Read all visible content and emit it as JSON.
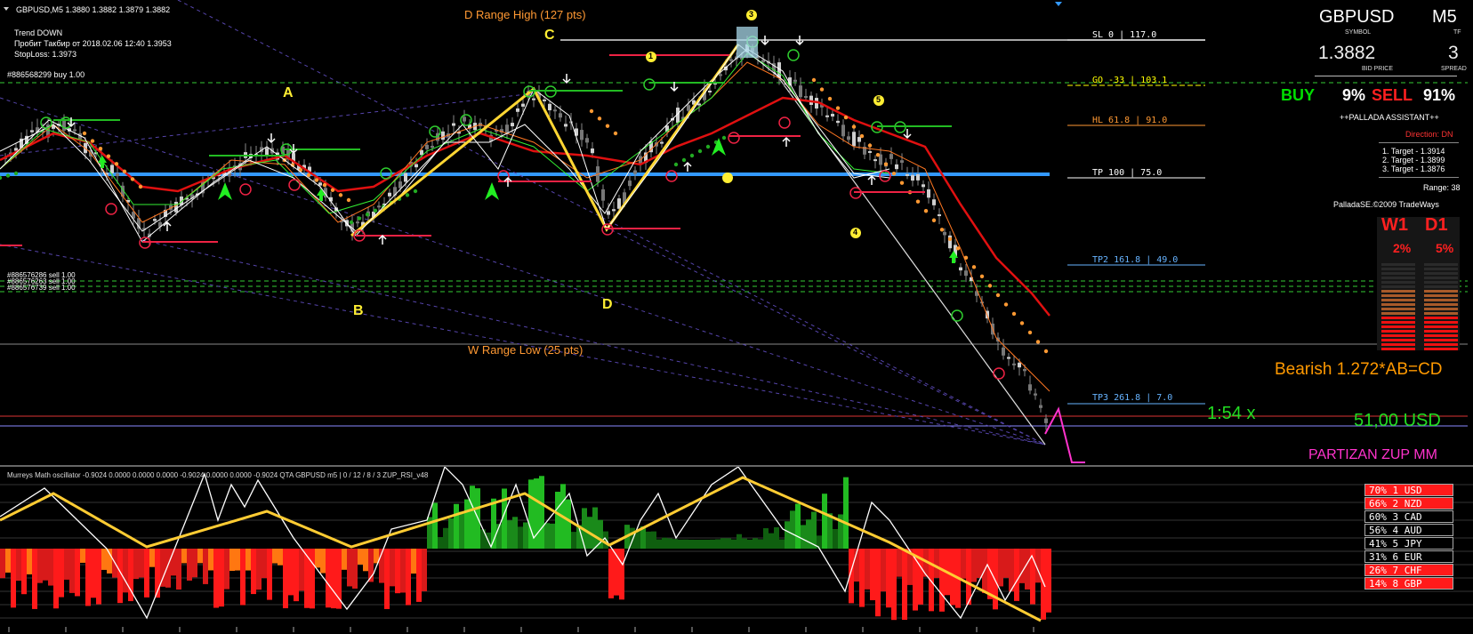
{
  "header": {
    "symbol_line": "GBPUSD,M5  1.3880 1.3882 1.3879 1.3882",
    "trend": "Trend DOWN",
    "breakout": "Пробит Такбир от 2018.02.06 12:40 1.3953",
    "stoploss": "StopLoss: 1.3973",
    "order1": "#886568299 buy 1.00",
    "order2": "#886576286 sell 1.00",
    "order3": "#886576263 sell 1.00",
    "order4": "#886576739 sell 1.00"
  },
  "labels": {
    "d_range_high": "D Range High (127 pts)",
    "w_range_low": "W Range Low (25 pts)",
    "point_a": "A",
    "point_b": "B",
    "point_c": "C",
    "point_d": "D",
    "wave1": "1",
    "wave3": "3",
    "wave4": "4",
    "wave5": "5",
    "ratio": "1:54 x",
    "bearish": "Bearish 1.272*AB=CD",
    "profit": "51,00 USD",
    "partizan": "PARTIZAN ZUP MM"
  },
  "levels": [
    {
      "name": "SL",
      "pct": "0",
      "pts": "117.0",
      "color": "#ffffff"
    },
    {
      "name": "GO",
      "pct": "-33",
      "pts": "103.1",
      "color": "#ffff00"
    },
    {
      "name": "HL",
      "pct": "61.8",
      "pts": "91.0",
      "color": "#ff9933"
    },
    {
      "name": "TP",
      "pct": "100",
      "pts": "75.0",
      "color": "#ffffff"
    },
    {
      "name": "TP2",
      "pct": "161.8",
      "pts": "49.0",
      "color": "#66b3ff"
    },
    {
      "name": "TP3",
      "pct": "261.8",
      "pts": "7.0",
      "color": "#66b3ff"
    }
  ],
  "panel": {
    "symbol": "GBPUSD",
    "symbol_caption": "SYMBOL",
    "tf": "M5",
    "tf_caption": "TF",
    "bid": "1.3882",
    "bid_caption": "BID PRICE",
    "spread": "3",
    "spread_caption": "SPREAD",
    "buy_label": "BUY",
    "buy_pct": "9%",
    "sell_label": "SELL",
    "sell_pct": "91%",
    "assistant": "++PALLADA ASSISTANT++",
    "direction": "Direction: DN",
    "target1": "1. Target - 1.3914",
    "target2": "2. Target - 1.3899",
    "target3": "3. Target - 1.3876",
    "range": "Range: 38",
    "copyright": "PalladaSE.©2009 TradeWays",
    "w1": "W1",
    "d1": "D1",
    "w1_pct": "2%",
    "d1_pct": "5%"
  },
  "oscillator": {
    "title": "Murreys Math oscillator -0.9024 0.0000 0.0000 0.0000 -0.9024 0.0000 0.0000 -0.9024  QTA GBPUSD m5 | 0 / 12 / 8 / 3  ZUP_RSI_v48"
  },
  "currencies": [
    {
      "pct": "70%",
      "rank": "1",
      "code": "USD",
      "bg": "#ff1a1a"
    },
    {
      "pct": "66%",
      "rank": "2",
      "code": "NZD",
      "bg": "#ff1a1a"
    },
    {
      "pct": "60%",
      "rank": "3",
      "code": "CAD",
      "bg": "#000000"
    },
    {
      "pct": "56%",
      "rank": "4",
      "code": "AUD",
      "bg": "#000000"
    },
    {
      "pct": "41%",
      "rank": "5",
      "code": "JPY",
      "bg": "#000000"
    },
    {
      "pct": "31%",
      "rank": "6",
      "code": "EUR",
      "bg": "#000000"
    },
    {
      "pct": "26%",
      "rank": "7",
      "code": "CHF",
      "bg": "#ff1a1a"
    },
    {
      "pct": "14%",
      "rank": "8",
      "code": "GBP",
      "bg": "#ff1a1a"
    }
  ],
  "colors": {
    "up_label": "#00cc00",
    "down_label": "#ff2020",
    "level_gold": "#ff9900",
    "pink": "#ff33cc",
    "zigzag": "#ffcc00"
  }
}
